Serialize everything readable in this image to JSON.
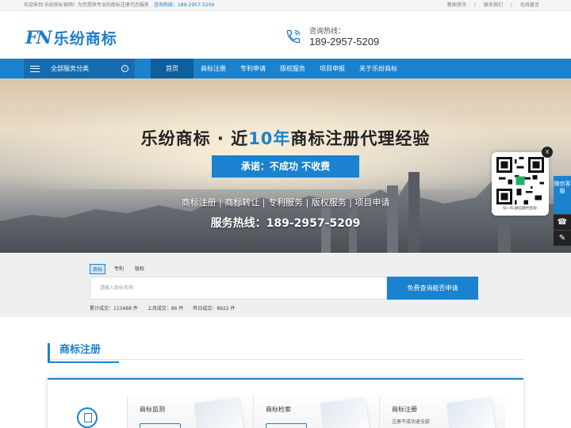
{
  "topbar": {
    "welcome": "欢迎来到 乐纷商标官网！为您提供专业的商标注册代办服务",
    "hotline": "咨询热线：189-2957-5209",
    "links": [
      "新闻资讯",
      "联系我们",
      "在线留言"
    ]
  },
  "header": {
    "logo_mark": "FN",
    "logo_text": "乐纷商标",
    "hotline_label": "咨询热线：",
    "hotline_number": "189-2957-5209"
  },
  "nav": {
    "all_categories": "全部服务分类",
    "items": [
      "首页",
      "商标注册",
      "专利申请",
      "版权服务",
      "项目申报",
      "关于乐纷商标"
    ]
  },
  "banner": {
    "title_pre": "乐纷商标 · 近",
    "title_accent": "10年",
    "title_post": "商标注册代理经验",
    "promise": "承诺：不成功 不收费",
    "services": "商标注册 | 商标转让 | 专利服务 | 版权服务 | 项目申请",
    "hotline": "服务热线：189-2957-5209"
  },
  "search": {
    "tabs": [
      "商标",
      "专利",
      "版权"
    ],
    "placeholder": "请输入商标名称",
    "button": "免费查询能否申请",
    "stats": [
      "累计成交：115688 件",
      "上月成交：86 件",
      "昨日成交：8922 件"
    ]
  },
  "section": {
    "title": "商标注册",
    "cards": [
      {
        "title": "商标监测",
        "sub": ""
      },
      {
        "title": "商标检索",
        "sub": ""
      },
      {
        "title": "商标注册",
        "sub": "注册不成功退全款"
      }
    ]
  },
  "float_qr": {
    "close": "X",
    "caption": "扫一扫,微信随时咨询!"
  },
  "sidebar": {
    "service": "微信客服"
  },
  "colors": {
    "brand_blue": "#1a82cf",
    "nav_dark": "#156db0"
  }
}
